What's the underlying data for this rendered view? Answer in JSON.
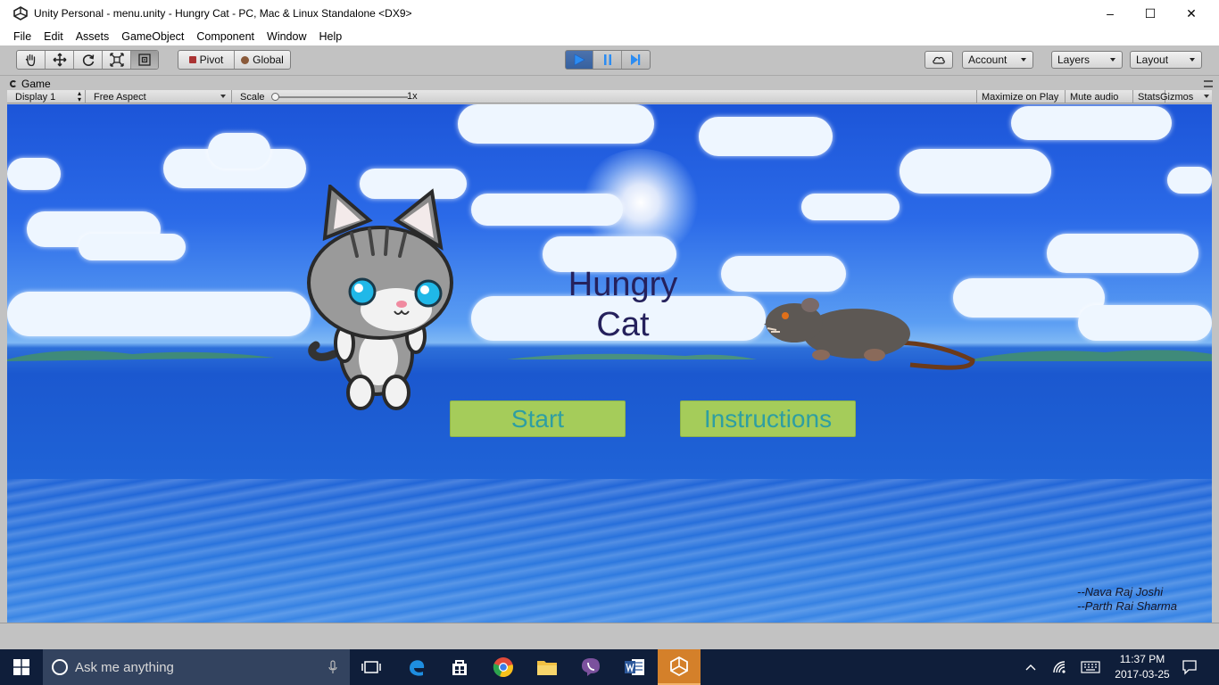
{
  "window": {
    "title": "Unity Personal - menu.unity - Hungry Cat - PC, Mac & Linux Standalone <DX9>",
    "minimize": "–",
    "maximize": "☐",
    "close": "✕"
  },
  "menu": [
    "File",
    "Edit",
    "Assets",
    "GameObject",
    "Component",
    "Window",
    "Help"
  ],
  "toolbar": {
    "tools": [
      "hand-tool",
      "move-tool",
      "rotate-tool",
      "scale-tool",
      "rect-tool"
    ],
    "active_tool": "rect-tool",
    "pivot_label": "Pivot",
    "global_label": "Global",
    "account_label": "Account",
    "layers_label": "Layers",
    "layout_label": "Layout",
    "play_state": "playing"
  },
  "game_tab": {
    "label": "Game",
    "display": "Display 1",
    "aspect": "Free Aspect",
    "scale_label": "Scale",
    "scale_value": "1x",
    "maximize_on_play": "Maximize on Play",
    "mute_audio": "Mute audio",
    "stats": "Stats",
    "gizmos": "Gizmos"
  },
  "game": {
    "title_line1": "Hungry",
    "title_line2": "Cat",
    "start_label": "Start",
    "instructions_label": "Instructions",
    "credit1": "--Nava Raj Joshi",
    "credit2": "--Parth Rai Sharma",
    "colors": {
      "button_bg": "#a5cc5a",
      "button_text": "#2e9ea2",
      "title_text": "#25215c"
    }
  },
  "taskbar": {
    "search_placeholder": "Ask me anything",
    "apps": [
      "task-view",
      "edge",
      "store",
      "chrome",
      "file-explorer",
      "viber",
      "word",
      "unity"
    ],
    "active_app": "unity",
    "time": "11:37 PM",
    "date": "2017-03-25"
  }
}
